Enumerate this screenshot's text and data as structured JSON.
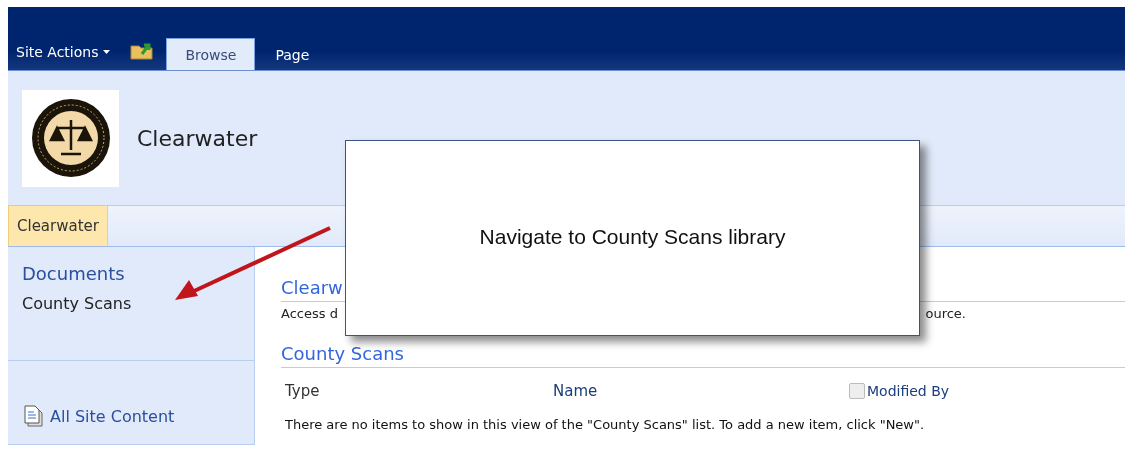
{
  "ribbon": {
    "site_actions": "Site Actions",
    "tabs": [
      {
        "label": "Browse",
        "selected": true
      },
      {
        "label": "Page",
        "selected": false
      }
    ]
  },
  "header": {
    "site_title": "Clearwater"
  },
  "breadcrumb": [
    {
      "label": "Clearwater",
      "selected": true
    }
  ],
  "sidebar": {
    "heading": "Documents",
    "items": [
      "County Scans"
    ],
    "footer_link": "All Site Content"
  },
  "content": {
    "section_title": "Clearw",
    "description_parts": [
      "Access d",
      "ource."
    ],
    "list_title": "County Scans",
    "columns": [
      "Type",
      "Name",
      "Modified By"
    ],
    "empty_message": "There are no items to show in this view of the \"County Scans\" list. To add a new item, click \"New\"."
  },
  "callout": {
    "text": "Navigate to County Scans library"
  }
}
